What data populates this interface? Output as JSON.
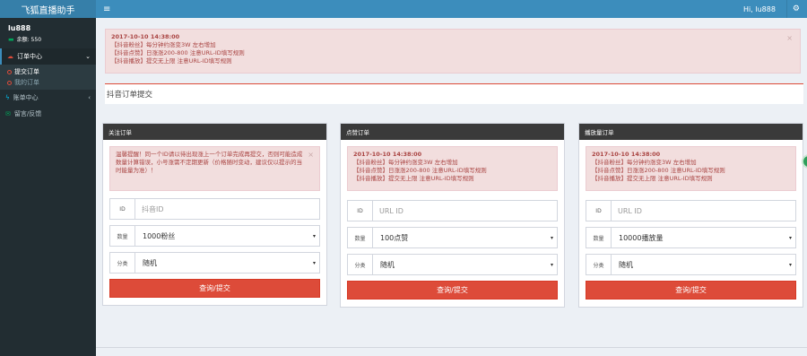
{
  "logo": "飞狐直播助手",
  "header": {
    "user": "Hi, lu888"
  },
  "sidebar": {
    "username": "lu888",
    "balance": "余额: 550",
    "menu": [
      {
        "label": "订单中心"
      },
      {
        "label": "提交订单"
      },
      {
        "label": "我的订单"
      },
      {
        "label": "账单中心"
      },
      {
        "label": "留言/反馈"
      }
    ]
  },
  "notice": {
    "time": "2017-10-10 14:38:00",
    "lines": [
      "【抖音粉丝】每分钟约涨变3W 左右增加",
      "【抖音点赞】日涨涨200-800 注意URL-ID填写规则",
      "【抖音播放】提交无上限 注意URL-ID填写规则"
    ]
  },
  "page_title": "抖音订单提交",
  "boxes": [
    {
      "title": "关注订单",
      "alert": "温馨提醒！同一个ID请以待出现涨上一个订单完成再提交，否则可能造成数量计算错误，小号涨需不定期更新（价格随时变动，建议仅以提示的当时能量为准）！",
      "id_label": "ID",
      "id_placeholder": "抖音ID",
      "qty_label": "数量",
      "qty_value": "1000粉丝",
      "type_label": "分类",
      "type_value": "随机",
      "button": "查询/提交"
    },
    {
      "title": "点赞订单",
      "id_label": "ID",
      "id_placeholder": "URL ID",
      "qty_label": "数量",
      "qty_value": "100点赞",
      "type_label": "分类",
      "type_value": "随机",
      "button": "查询/提交"
    },
    {
      "title": "播放量订单",
      "id_label": "ID",
      "id_placeholder": "URL ID",
      "qty_label": "数量",
      "qty_value": "10000播放量",
      "type_label": "分类",
      "type_value": "随机",
      "button": "查询/提交"
    }
  ],
  "colors": {
    "navbar": "#3c8dbc",
    "sidebar": "#222d32",
    "danger": "#dd4b39",
    "alert_bg": "#f2dede"
  }
}
